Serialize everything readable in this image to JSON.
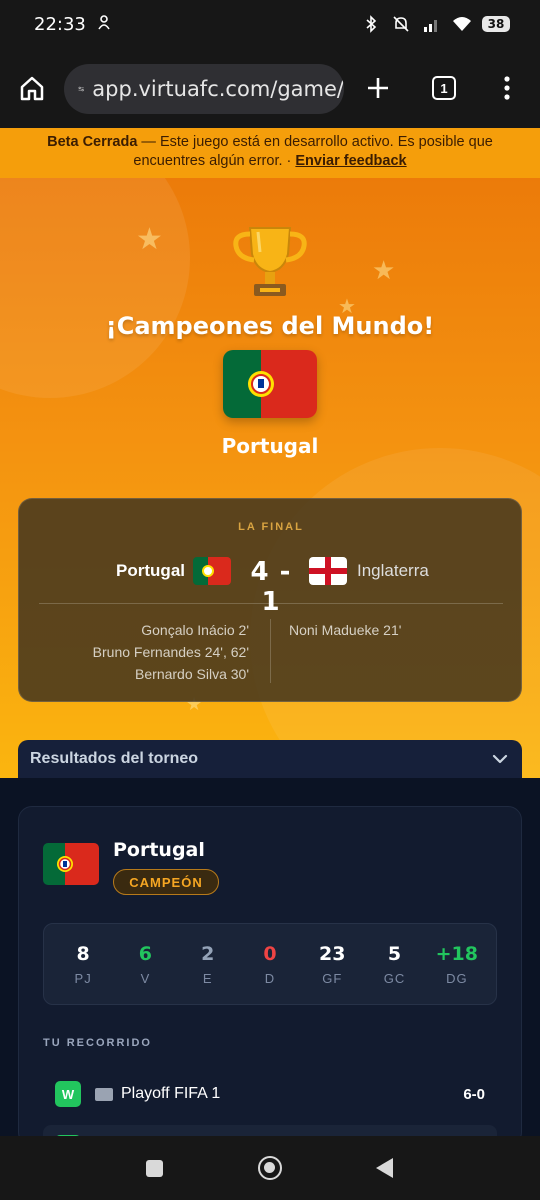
{
  "status": {
    "time": "22:33",
    "battery": "38"
  },
  "browser": {
    "url": "app.virtuafc.com/game/",
    "tab_count": "1"
  },
  "banner": {
    "bold": "Beta Cerrada",
    "text": " — Este juego está en desarrollo activo. Es posible que encuentres algún error. · ",
    "link": "Enviar feedback"
  },
  "hero": {
    "title": "¡Campeones del Mundo!",
    "champion": "Portugal",
    "star_glyph": "★"
  },
  "final": {
    "label": "LA FINAL",
    "home_team": "Portugal",
    "away_team": "Inglaterra",
    "score": "4 - 1",
    "home_scorers": [
      "Gonçalo Inácio 2'",
      "Bruno Fernandes 24', 62'",
      "Bernardo Silva 30'"
    ],
    "away_scorers": [
      "Noni Madueke 21'"
    ]
  },
  "results": {
    "label": "Resultados del torneo"
  },
  "team_card": {
    "name": "Portugal",
    "badge": "CAMPEÓN",
    "stats": [
      {
        "value": "8",
        "label": "PJ",
        "color": "#ffffff"
      },
      {
        "value": "6",
        "label": "V",
        "color": "#22c55e"
      },
      {
        "value": "2",
        "label": "E",
        "color": "#94a3b8"
      },
      {
        "value": "0",
        "label": "D",
        "color": "#ef4444"
      },
      {
        "value": "23",
        "label": "GF",
        "color": "#ffffff"
      },
      {
        "value": "5",
        "label": "GC",
        "color": "#ffffff"
      },
      {
        "value": "+18",
        "label": "DG",
        "color": "#22c55e"
      }
    ],
    "path_label": "TU RECORRIDO",
    "matches": [
      {
        "result": "W",
        "name": "Playoff FIFA 1",
        "score": "6-0"
      }
    ],
    "next_result": "W"
  },
  "colors": {
    "accent": "#f59e0b",
    "win": "#22c55e",
    "portugal_green": "#046a38",
    "portugal_red": "#da291c"
  }
}
